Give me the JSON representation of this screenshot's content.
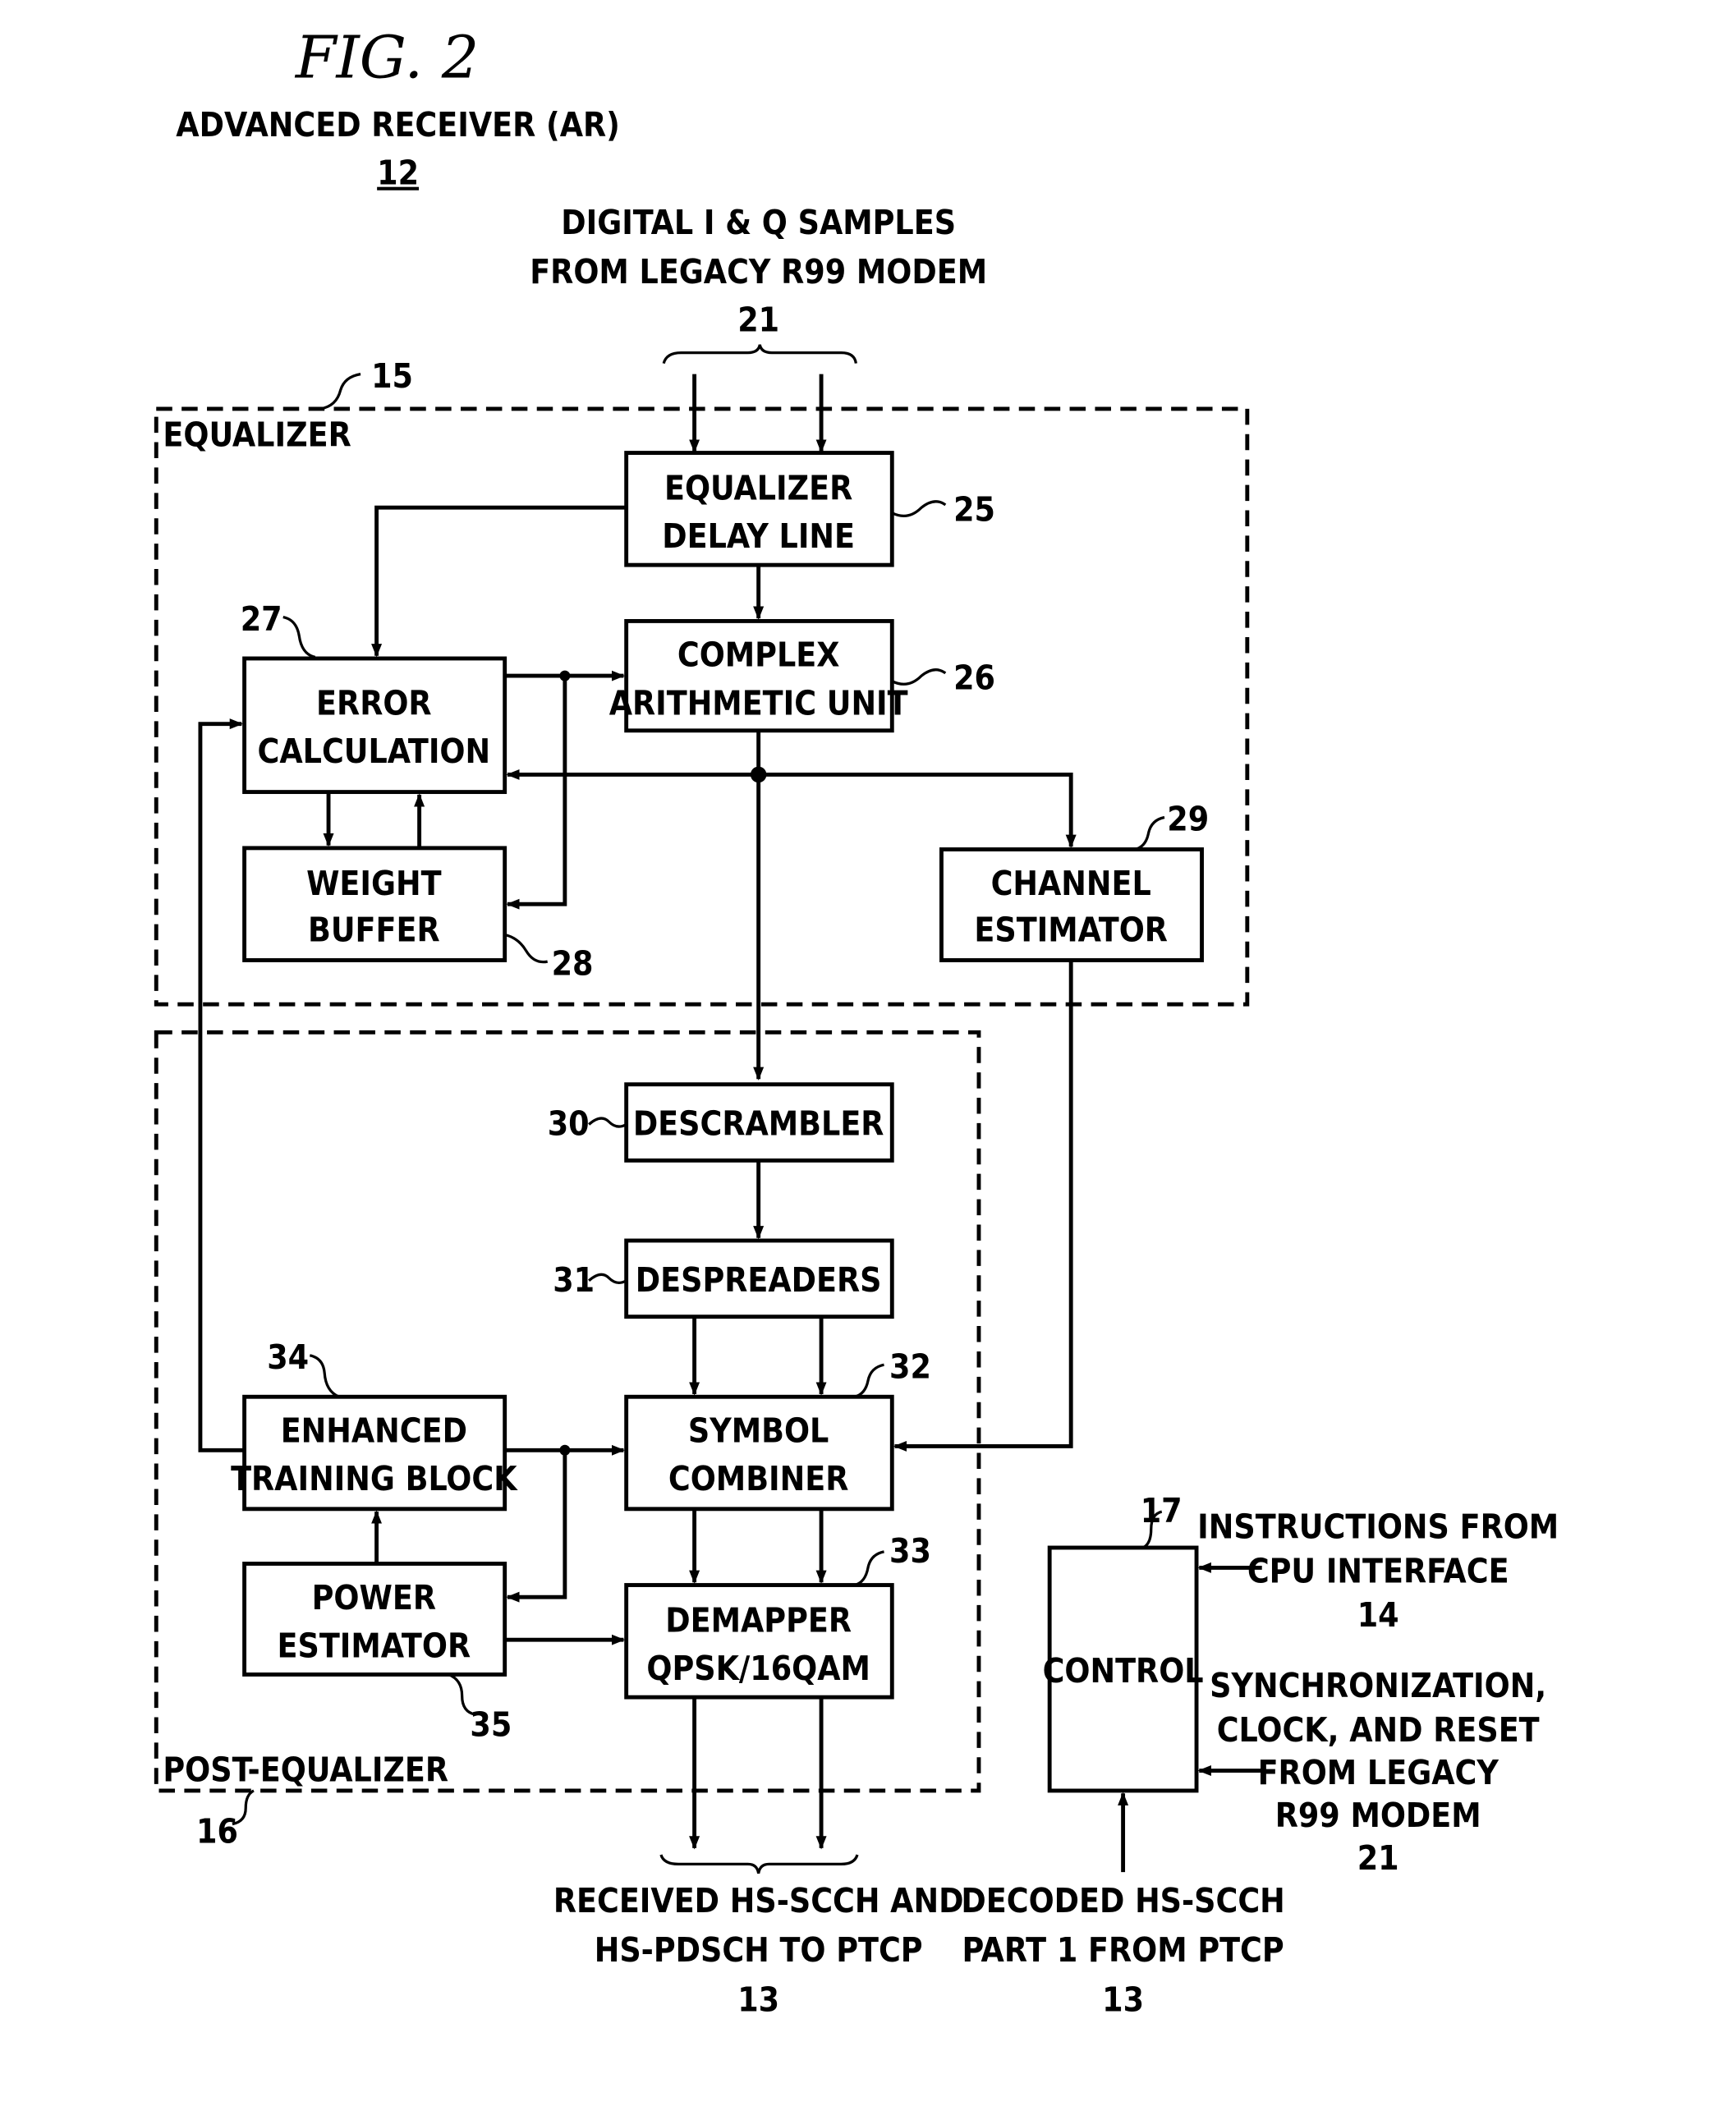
{
  "figure": {
    "title": "FIG. 2",
    "subtitle": "ADVANCED RECEIVER (AR)",
    "ref": "12"
  },
  "inputs": {
    "iq_line1": "DIGITAL I & Q SAMPLES",
    "iq_line2": "FROM LEGACY R99 MODEM",
    "iq_ref": "21",
    "cpu_line1": "INSTRUCTIONS FROM",
    "cpu_line2": "CPU INTERFACE",
    "cpu_ref": "14",
    "sync_line1": "SYNCHRONIZATION,",
    "sync_line2": "CLOCK, AND RESET",
    "sync_line3": "FROM LEGACY",
    "sync_line4": "R99 MODEM",
    "sync_ref": "21",
    "decoded_line1": "DECODED HS-SCCH",
    "decoded_line2": "PART 1 FROM PTCP",
    "decoded_ref": "13"
  },
  "outputs": {
    "line1": "RECEIVED HS-SCCH AND",
    "line2": "HS-PDSCH TO PTCP",
    "ref": "13"
  },
  "groups": {
    "equalizer": {
      "label": "EQUALIZER",
      "ref": "15"
    },
    "post_equalizer": {
      "label": "POST-EQUALIZER",
      "ref": "16"
    }
  },
  "blocks": {
    "delay_line": {
      "line1": "EQUALIZER",
      "line2": "DELAY LINE",
      "ref": "25"
    },
    "complex_au": {
      "line1": "COMPLEX",
      "line2": "ARITHMETIC UNIT",
      "ref": "26"
    },
    "error_calc": {
      "line1": "ERROR",
      "line2": "CALCULATION",
      "ref": "27"
    },
    "weight_buffer": {
      "line1": "WEIGHT",
      "line2": "BUFFER",
      "ref": "28"
    },
    "channel_est": {
      "line1": "CHANNEL",
      "line2": "ESTIMATOR",
      "ref": "29"
    },
    "descrambler": {
      "line1": "DESCRAMBLER",
      "ref": "30"
    },
    "despreaders": {
      "line1": "DESPREADERS",
      "ref": "31"
    },
    "symbol_combiner": {
      "line1": "SYMBOL",
      "line2": "COMBINER",
      "ref": "32"
    },
    "demapper": {
      "line1": "DEMAPPER",
      "line2": "QPSK/16QAM",
      "ref": "33"
    },
    "enhanced_training": {
      "line1": "ENHANCED",
      "line2": "TRAINING BLOCK",
      "ref": "34"
    },
    "power_est": {
      "line1": "POWER",
      "line2": "ESTIMATOR",
      "ref": "35"
    },
    "control": {
      "line1": "CONTROL",
      "ref": "17"
    }
  }
}
